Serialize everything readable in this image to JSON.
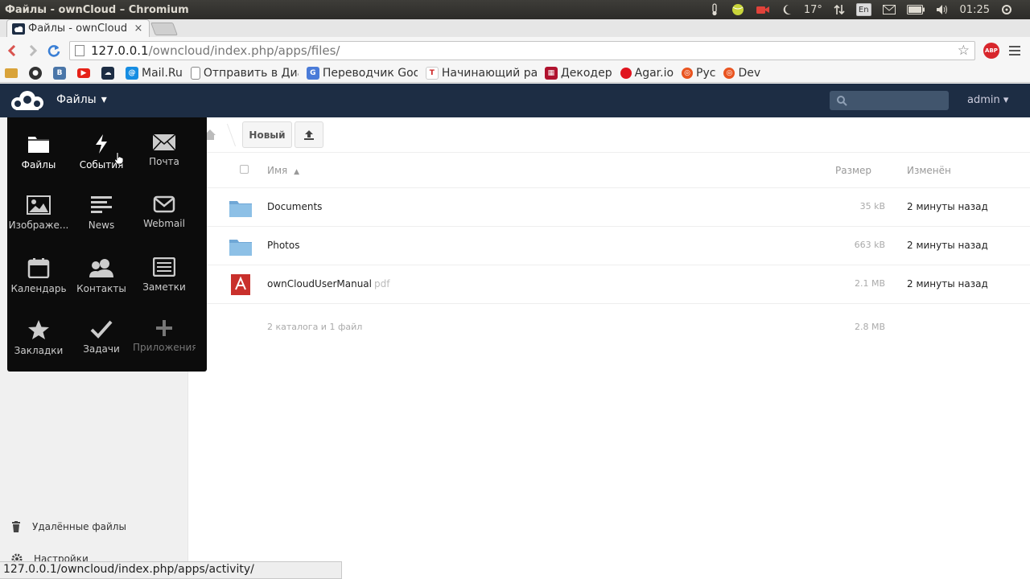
{
  "os_bar": {
    "window_title": "Файлы - ownCloud – Chromium",
    "temperature": "17°",
    "keyboard_layout": "En",
    "clock": "01:25"
  },
  "browser": {
    "tab_title": "Файлы - ownCloud",
    "tab_close": "×",
    "url_host": "127.0.0.1",
    "url_path": "/owncloud/index.php/apps/files/",
    "extension_badge": "ABP",
    "bookmarks": [
      {
        "label": "",
        "icon": "folder-icon",
        "color": "#d9a33a"
      },
      {
        "label": "",
        "icon": "github-icon",
        "color": "#333333"
      },
      {
        "label": "",
        "icon": "vk-icon",
        "color": "#4a76a8"
      },
      {
        "label": "",
        "icon": "youtube-icon",
        "color": "#e62117"
      },
      {
        "label": "",
        "icon": "owncloud-icon",
        "color": "#1d2d44"
      },
      {
        "label": "Mail.Ru",
        "icon": "mailru-icon",
        "color": "#168de2"
      },
      {
        "label": "Отправить в Диа",
        "icon": "page-icon",
        "color": "#ffffff"
      },
      {
        "label": "Переводчик Goo",
        "icon": "translate-icon",
        "color": "#4a7bd8"
      },
      {
        "label": "Начинающий ра",
        "icon": "antenna-icon",
        "color": "#c22"
      },
      {
        "label": "Декодер",
        "icon": "decoder-icon",
        "color": "#b0122e"
      },
      {
        "label": "Agar.io",
        "icon": "agar-icon",
        "color": "#e0141e"
      },
      {
        "label": "Рус",
        "icon": "ubuntu-icon",
        "color": "#e95420"
      },
      {
        "label": "Dev",
        "icon": "ubuntu-icon",
        "color": "#e95420"
      }
    ]
  },
  "header": {
    "app_menu_label": "Файлы",
    "app_menu_caret": "▾",
    "user_label": "admin ▾"
  },
  "apps_popup": [
    {
      "label": "Файлы",
      "icon": "folder-icon",
      "state": "active"
    },
    {
      "label": "События",
      "icon": "lightning-icon",
      "state": "active"
    },
    {
      "label": "Почта",
      "icon": "mail-icon",
      "state": "normal"
    },
    {
      "label": "Изображе...",
      "icon": "image-icon",
      "state": "normal"
    },
    {
      "label": "News",
      "icon": "news-icon",
      "state": "normal"
    },
    {
      "label": "Webmail",
      "icon": "envelope-icon",
      "state": "normal"
    },
    {
      "label": "Календарь",
      "icon": "calendar-icon",
      "state": "normal"
    },
    {
      "label": "Контакты",
      "icon": "contacts-icon",
      "state": "normal"
    },
    {
      "label": "Заметки",
      "icon": "notes-icon",
      "state": "normal"
    },
    {
      "label": "Закладки",
      "icon": "star-icon",
      "state": "normal"
    },
    {
      "label": "Задачи",
      "icon": "check-icon",
      "state": "normal"
    },
    {
      "label": "Приложения",
      "icon": "plus-icon",
      "state": "dim"
    }
  ],
  "toolbar": {
    "new_label": "Новый"
  },
  "file_table": {
    "col_name": "Имя",
    "col_name_sort": "▲",
    "col_size": "Размер",
    "col_modified": "Изменён",
    "rows": [
      {
        "name": "Documents",
        "ext": "",
        "size": "35 kB",
        "modified": "2 минуты назад",
        "type": "folder"
      },
      {
        "name": "Photos",
        "ext": "",
        "size": "663 kB",
        "modified": "2 минуты назад",
        "type": "folder"
      },
      {
        "name": "ownCloudUserManual",
        "ext": "pdf",
        "size": "2.1 MB",
        "modified": "2 минуты назад",
        "type": "pdf"
      }
    ],
    "summary_text": "2 каталога и 1 файл",
    "summary_size": "2.8 MB"
  },
  "sidebar": {
    "deleted_files": "Удалённые файлы",
    "settings": "Настройки"
  },
  "status_url": "127.0.0.1/owncloud/index.php/apps/activity/"
}
